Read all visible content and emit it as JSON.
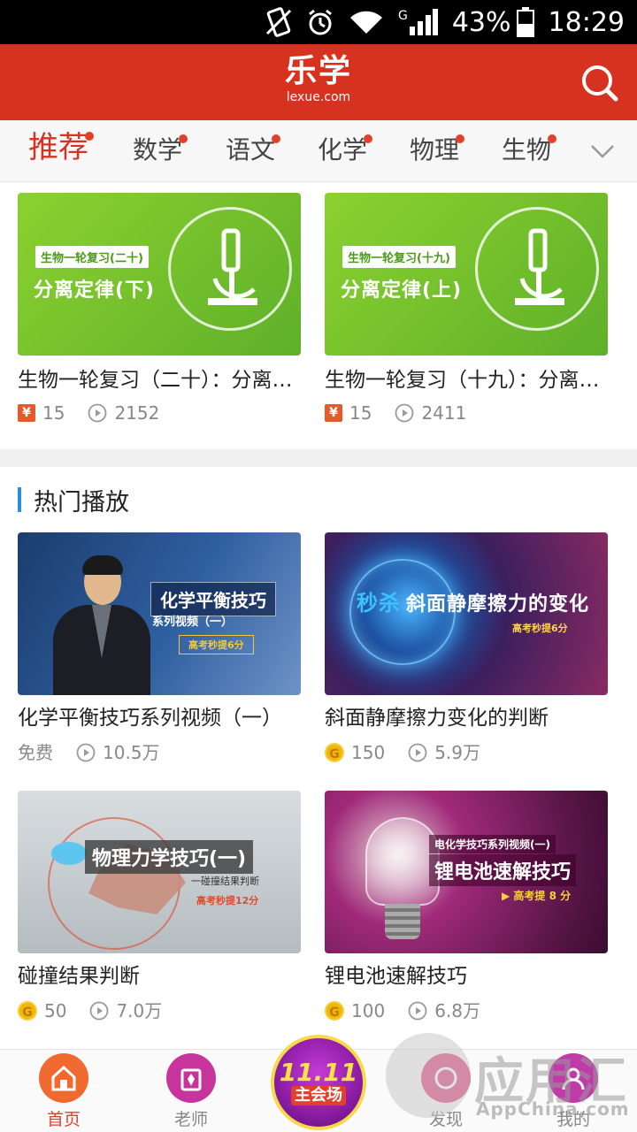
{
  "status_bar": {
    "battery": "43%",
    "time": "18:29",
    "signal": "G"
  },
  "header": {
    "logo_cn": "乐学",
    "logo_en": "lexue.com"
  },
  "tabs": [
    {
      "label": "推荐",
      "active": true
    },
    {
      "label": "数学"
    },
    {
      "label": "语文"
    },
    {
      "label": "化学"
    },
    {
      "label": "物理"
    },
    {
      "label": "生物"
    }
  ],
  "top_cards": [
    {
      "tag": "生物一轮复习(二十)",
      "headline": "分离定律(下)",
      "title": "生物一轮复习（二十）：分离…",
      "price": "15",
      "views": "2152"
    },
    {
      "tag": "生物一轮复习(十九)",
      "headline": "分离定律(上)",
      "title": "生物一轮复习（十九）：分离…",
      "price": "15",
      "views": "2411"
    }
  ],
  "section": {
    "title": "热门播放"
  },
  "hot_cards": [
    {
      "overlay_title": "化学平衡技巧",
      "overlay_sub": "系列视频（一）",
      "overlay_badge": "高考秒提6分",
      "title": "化学平衡技巧系列视频（一）",
      "price": "免费",
      "views": "10.5万"
    },
    {
      "overlay_key": "秒杀",
      "overlay_title": "斜面静摩擦力的变化",
      "overlay_badge": "高考秒提6分",
      "title": "斜面静摩擦力变化的判断",
      "price": "150",
      "views": "5.9万"
    },
    {
      "overlay_title": "物理力学技巧(一)",
      "overlay_sub": "一碰撞结果判断",
      "overlay_badge": "高考秒提12分",
      "title": "碰撞结果判断",
      "price": "50",
      "views": "7.0万"
    },
    {
      "overlay_sub": "电化学技巧系列视频(一)",
      "overlay_title": "锂电池速解技巧",
      "overlay_badge": "▶ 高考提 8 分",
      "title": "锂电池速解技巧",
      "price": "100",
      "views": "6.8万"
    }
  ],
  "bottom_nav": [
    {
      "label": "首页",
      "active": true
    },
    {
      "label": "老师"
    },
    {
      "label": "发现"
    },
    {
      "label": "我的"
    }
  ],
  "promo": {
    "line1": "11.11",
    "line2": "主会场"
  },
  "watermark": {
    "cn": "应用汇",
    "en": "AppChina.com"
  },
  "colors": {
    "brand": "#d7321f",
    "accent_blue": "#2f8de4",
    "coin": "#f2b705"
  }
}
